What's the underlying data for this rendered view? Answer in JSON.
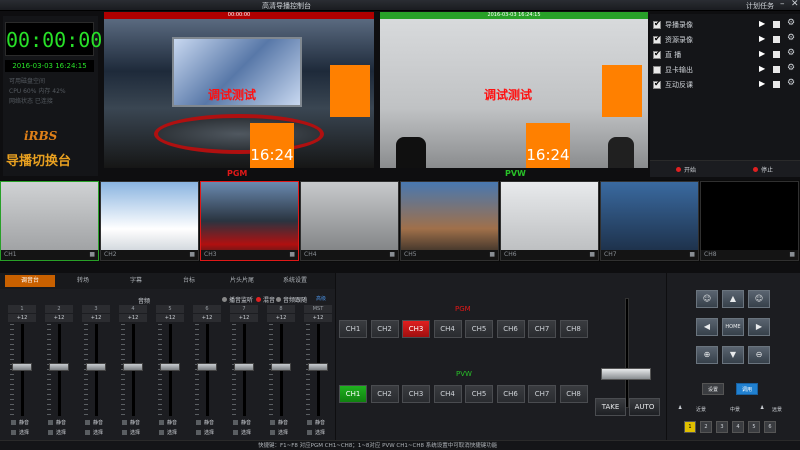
{
  "window": {
    "title": "高清导播控制台",
    "schedule": "计划任务",
    "minimize": "–",
    "close": "✕"
  },
  "clock": {
    "timer": "00:00:00",
    "date": "2016-03-03 16:24:15",
    "info": [
      "可用磁盘空间",
      "CPU 60% 内存 42%",
      "网络状态 已连接"
    ],
    "logo": "iRBS",
    "app_name": "导播切换台"
  },
  "monitors": {
    "pgm": {
      "label": "PGM",
      "bar_text": "00:00:00",
      "overlay_text": "调试测试",
      "clock": "16:24"
    },
    "pvw": {
      "label": "PVW",
      "bar_text": "2016-03-03 16:24:15",
      "overlay_text": "调试测试",
      "clock": "16:24"
    }
  },
  "tasks": {
    "items": [
      {
        "label": "导播录像",
        "checked": true
      },
      {
        "label": "资源录像",
        "checked": true
      },
      {
        "label": "直 播",
        "checked": true
      },
      {
        "label": "显卡输出",
        "checked": false
      },
      {
        "label": "互动反课",
        "checked": true
      }
    ],
    "start": "开始",
    "stop": "停止"
  },
  "thumbnails": [
    "CH1",
    "CH2",
    "CH3",
    "CH4",
    "CH5",
    "CH6",
    "CH7",
    "CH8"
  ],
  "tabs": [
    "调音台",
    "转场",
    "字幕",
    "台标",
    "片头片尾",
    "系统设置"
  ],
  "mixer": {
    "master_label": "音频",
    "radios": [
      {
        "label": "播音监听",
        "on": false
      },
      {
        "label": "混音",
        "on": true
      },
      {
        "label": "音频跟随",
        "on": false
      }
    ],
    "extra_link": "高级",
    "channels": [
      {
        "num": "1",
        "gain": "+12"
      },
      {
        "num": "2",
        "gain": "+12"
      },
      {
        "num": "3",
        "gain": "+12"
      },
      {
        "num": "4",
        "gain": "+12"
      },
      {
        "num": "5",
        "gain": "+12"
      },
      {
        "num": "6",
        "gain": "+12"
      },
      {
        "num": "7",
        "gain": "+12"
      },
      {
        "num": "8",
        "gain": "+12"
      },
      {
        "num": "MST",
        "gain": "+12"
      }
    ],
    "mute": "静音",
    "solo": "选择"
  },
  "switcher": {
    "pgm_label": "PGM",
    "pvw_label": "PVW",
    "channels": [
      "CH1",
      "CH2",
      "CH3",
      "CH4",
      "CH5",
      "CH6",
      "CH7",
      "CH8"
    ],
    "pgm_active": 2,
    "pvw_active": 0,
    "take": "TAKE",
    "auto": "AUTO"
  },
  "ptz": {
    "home": "HOME",
    "set": "设置",
    "call": "调用",
    "near": "近景",
    "mid": "中景",
    "far": "远景",
    "presets": [
      "1",
      "2",
      "3",
      "4",
      "5",
      "6"
    ]
  },
  "status": {
    "text": "快捷键：F1~F8 对应PGM CH1~CH8；1~8对应 PVW CH1~CH8    系统设置中可取消快捷键功能"
  },
  "colors": {
    "pgm": "#e01818",
    "pvw": "#28c028",
    "accent": "#c86000"
  }
}
